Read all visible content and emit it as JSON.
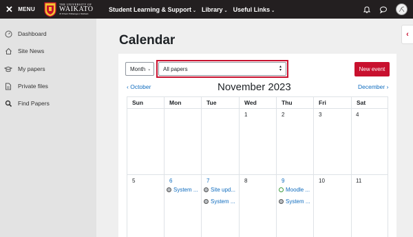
{
  "navbar": {
    "menu_label": "MENU",
    "logo": {
      "small_text": "THE UNIVERSITY OF",
      "big_text": "WAIKATO",
      "sub_text": "Te Whare Wānanga o Waikato"
    },
    "links": [
      {
        "label": "Student Learning & Support"
      },
      {
        "label": "Library"
      },
      {
        "label": "Useful Links"
      }
    ]
  },
  "sidebar": {
    "items": [
      {
        "label": "Dashboard",
        "icon": "dashboard-icon"
      },
      {
        "label": "Site News",
        "icon": "home-icon"
      },
      {
        "label": "My papers",
        "icon": "graduation-cap-icon"
      },
      {
        "label": "Private files",
        "icon": "file-icon"
      },
      {
        "label": "Find Papers",
        "icon": "search-icon"
      }
    ]
  },
  "page": {
    "title": "Calendar"
  },
  "controls": {
    "view_select": "Month",
    "paper_select": "All papers",
    "new_event": "New event"
  },
  "calendar": {
    "prev_month": "October",
    "month_title": "November 2023",
    "next_month": "December",
    "weekdays": [
      "Sun",
      "Mon",
      "Tue",
      "Wed",
      "Thu",
      "Fri",
      "Sat"
    ],
    "week1": [
      "1",
      "2",
      "3",
      "4"
    ],
    "week2": [
      "5",
      "6",
      "7",
      "8",
      "9",
      "10",
      "11"
    ],
    "events": {
      "mon6_1": "System ...",
      "tue7_1": "Site upd...",
      "tue7_2": "System ...",
      "thu9_1": "Moodle ...",
      "thu9_2": "System ..."
    }
  },
  "colors": {
    "accent": "#c8102e",
    "link": "#0f6cbf",
    "navbar": "#231f20"
  }
}
